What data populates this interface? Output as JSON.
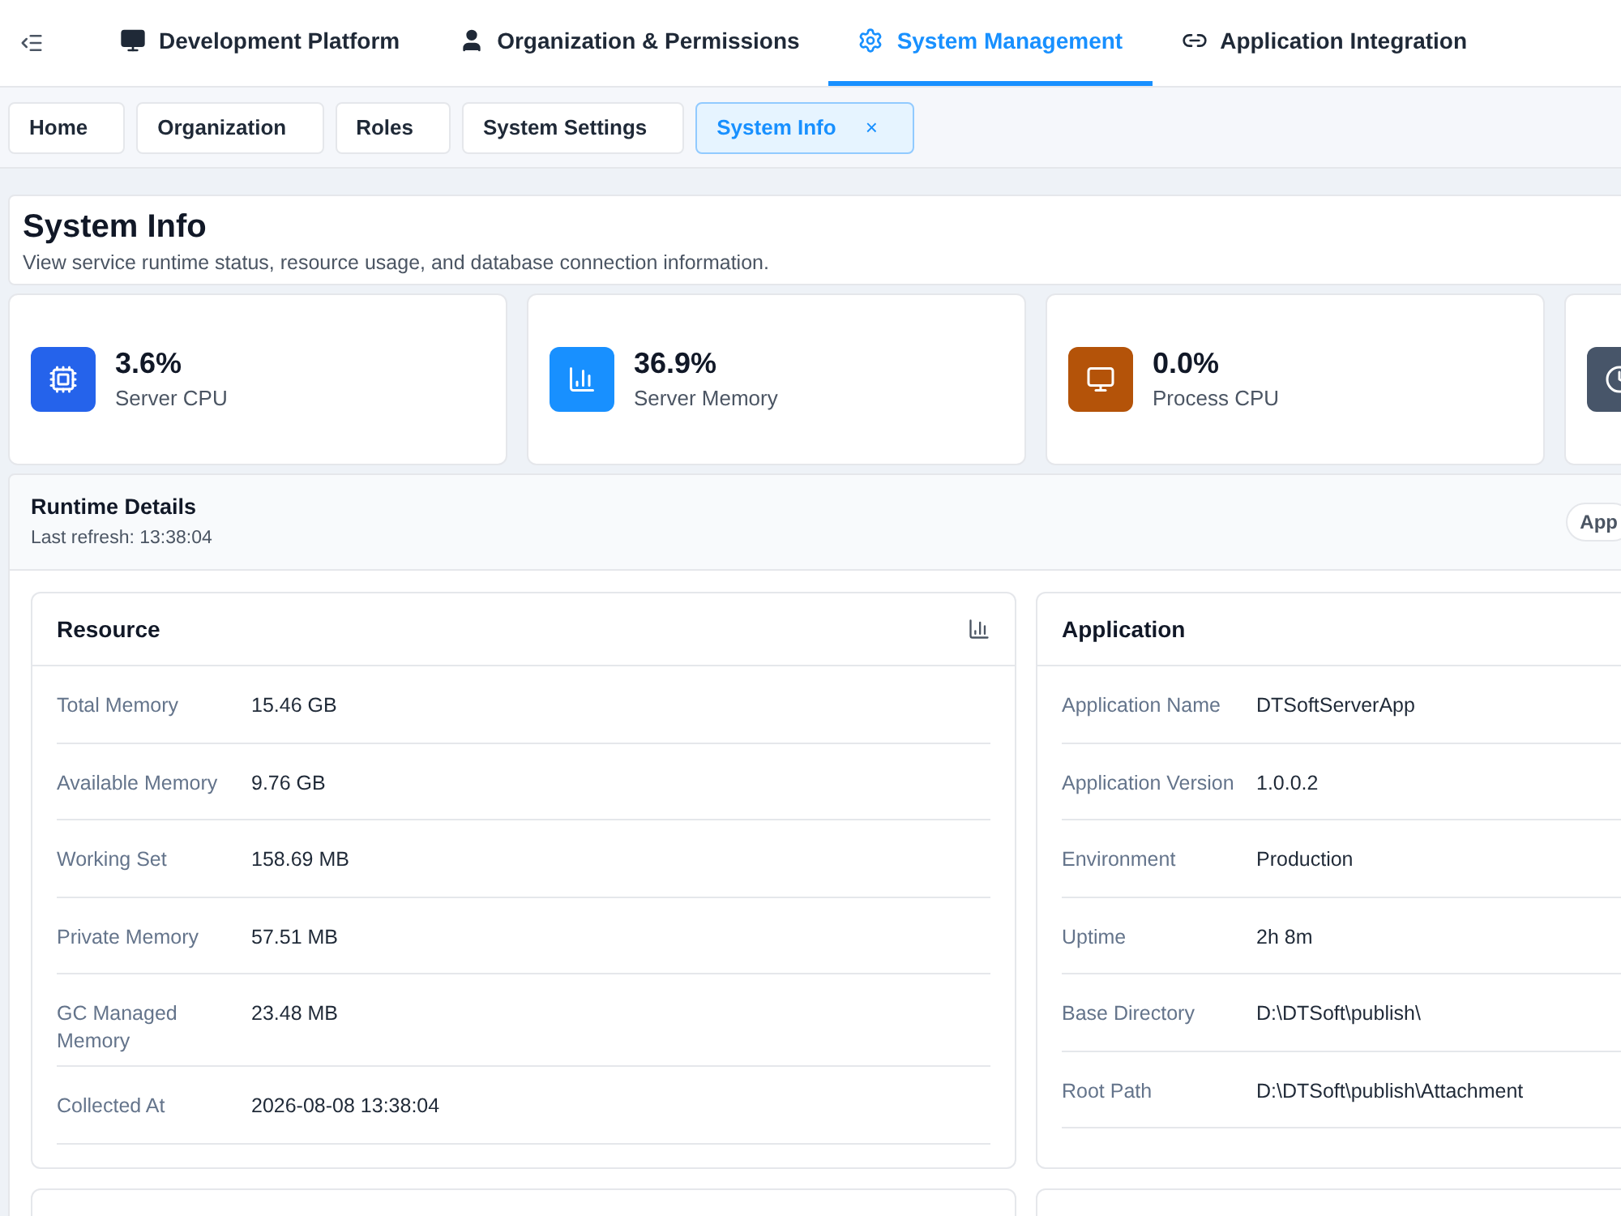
{
  "nav": [
    {
      "label": "Development Platform",
      "kind": "monitor",
      "selected": false
    },
    {
      "label": "Organization & Permissions",
      "kind": "user",
      "selected": false
    },
    {
      "label": "System Management",
      "kind": "gear",
      "selected": true
    },
    {
      "label": "Application Integration",
      "kind": "link",
      "selected": false
    }
  ],
  "tabs": [
    {
      "label": "Home",
      "selected": false,
      "closable": false
    },
    {
      "label": "Organization",
      "selected": false,
      "closable": false
    },
    {
      "label": "Roles",
      "selected": false,
      "closable": false
    },
    {
      "label": "System Settings",
      "selected": false,
      "closable": false
    },
    {
      "label": "System Info",
      "selected": true,
      "closable": true,
      "close": "×"
    }
  ],
  "header": {
    "title": "System Info",
    "subtitle": "View service runtime status, resource usage, and database connection information."
  },
  "stats": [
    {
      "kind": "cpu",
      "color": "#2563eb",
      "value": "3.6%",
      "label": "Server CPU"
    },
    {
      "kind": "bars",
      "color": "#1890ff",
      "value": "36.9%",
      "label": "Server Memory"
    },
    {
      "kind": "monitor",
      "color": "#b45309",
      "value": "0.0%",
      "label": "Process CPU"
    },
    {
      "kind": "clock",
      "color": "#475569"
    }
  ],
  "runtime": {
    "title": "Runtime Details",
    "refresh": "Last refresh: 13:38:04",
    "button": "App"
  },
  "panels": [
    {
      "title": "Resource",
      "has_chart_icon": true,
      "rows": [
        {
          "label": "Total Memory",
          "value": "15.46 GB"
        },
        {
          "label": "Available Memory",
          "value": "9.76 GB"
        },
        {
          "label": "Working Set",
          "value": "158.69 MB"
        },
        {
          "label": "Private Memory",
          "value": "57.51 MB"
        },
        {
          "label": "GC Managed Memory",
          "value": "23.48 MB"
        },
        {
          "label": "Collected At",
          "value": "2026-08-08 13:38:04"
        }
      ]
    },
    {
      "title": "Application",
      "rows": [
        {
          "label": "Application Name",
          "value": "DTSoftServerApp"
        },
        {
          "label": "Application Version",
          "value": "1.0.0.2"
        },
        {
          "label": "Environment",
          "value": "Production"
        },
        {
          "label": "Uptime",
          "value": "2h 8m"
        },
        {
          "label": "Base Directory",
          "value": "D:\\DTSoft\\publish\\"
        },
        {
          "label": "Root Path",
          "value": "D:\\DTSoft\\publish\\Attachment"
        }
      ]
    }
  ]
}
